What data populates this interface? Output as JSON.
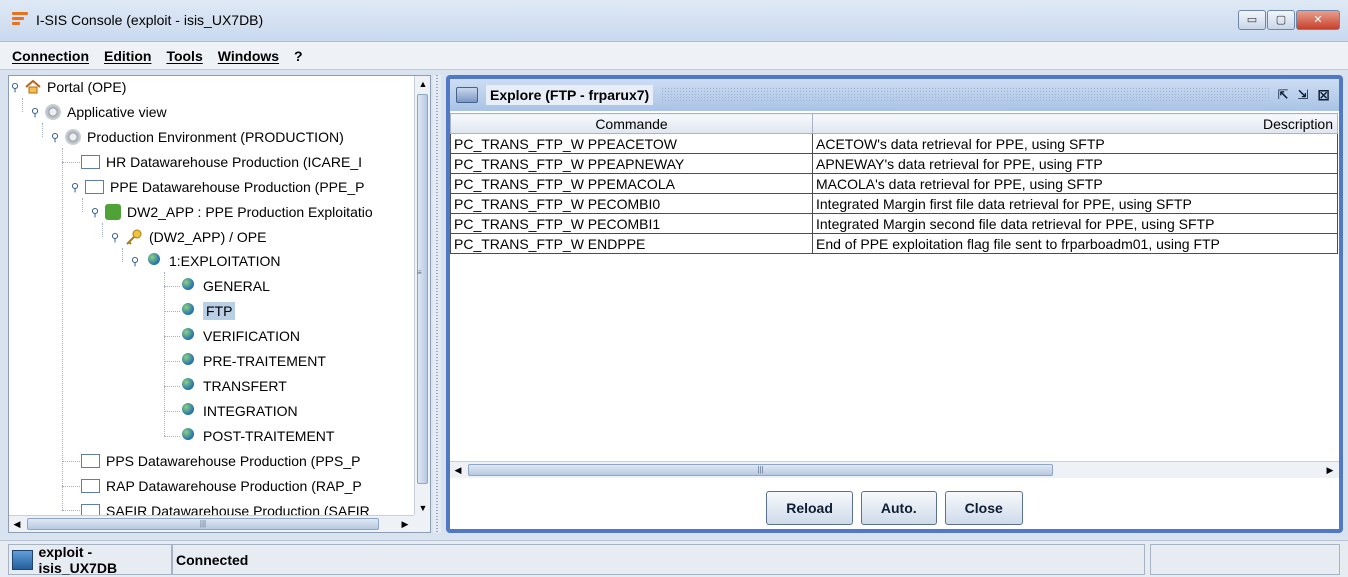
{
  "window": {
    "title": "I-SIS Console (exploit - isis_UX7DB)",
    "minimize_label": "▭",
    "maximize_label": "▢",
    "close_label": "✕"
  },
  "menu": [
    {
      "label": "Connection"
    },
    {
      "label": "Edition"
    },
    {
      "label": "Tools"
    },
    {
      "label": "Windows"
    },
    {
      "label": "?"
    }
  ],
  "tree": [
    {
      "label": "Portal (OPE)",
      "icon": "home-icon"
    },
    {
      "label": "Applicative view",
      "icon": "gear-icon"
    },
    {
      "label": "Production Environment (PRODUCTION)",
      "icon": "gear-icon"
    },
    {
      "label": "HR Datawarehouse Production (ICARE_I",
      "icon": "document-icon"
    },
    {
      "label": "PPE Datawarehouse Production (PPE_P",
      "icon": "document-icon"
    },
    {
      "label": "DW2_APP : PPE Production Exploitatio",
      "icon": "puzzle-icon"
    },
    {
      "label": "(DW2_APP) / OPE",
      "icon": "key-icon"
    },
    {
      "label": "1:EXPLOITATION",
      "icon": "globe-icon"
    },
    {
      "label": "GENERAL",
      "icon": "globe-icon"
    },
    {
      "label": "FTP",
      "icon": "globe-icon",
      "selected": true
    },
    {
      "label": "VERIFICATION",
      "icon": "globe-icon"
    },
    {
      "label": "PRE-TRAITEMENT",
      "icon": "globe-icon"
    },
    {
      "label": "TRANSFERT",
      "icon": "globe-icon"
    },
    {
      "label": "INTEGRATION",
      "icon": "globe-icon"
    },
    {
      "label": "POST-TRAITEMENT",
      "icon": "globe-icon"
    },
    {
      "label": "PPS Datawarehouse Production (PPS_P",
      "icon": "document-icon"
    },
    {
      "label": "RAP Datawarehouse Production (RAP_P",
      "icon": "document-icon"
    },
    {
      "label": "SAFIR Datawarehouse Production (SAFIR",
      "icon": "document-icon"
    }
  ],
  "explore": {
    "title": "Explore (FTP - frparux7)",
    "restore_label": "⇱",
    "maximize_label": "⇲",
    "close_label": "⊠",
    "columns": [
      "Commande",
      "Description"
    ],
    "rows": [
      [
        "PC_TRANS_FTP_W PPEACETOW",
        "ACETOW's data retrieval for PPE, using SFTP"
      ],
      [
        "PC_TRANS_FTP_W PPEAPNEWAY",
        "APNEWAY's data retrieval for PPE, using FTP"
      ],
      [
        "PC_TRANS_FTP_W PPEMACOLA",
        "MACOLA's data retrieval for PPE, using SFTP"
      ],
      [
        "PC_TRANS_FTP_W PECOMBI0",
        "Integrated Margin first file data retrieval for PPE, using SFTP"
      ],
      [
        "PC_TRANS_FTP_W PECOMBI1",
        "Integrated Margin second file data retrieval for PPE, using SFTP"
      ],
      [
        "PC_TRANS_FTP_W ENDPPE",
        "End of PPE exploitation flag file sent to frparboadm01, using FTP"
      ]
    ],
    "buttons": {
      "reload": "Reload",
      "auto": "Auto.",
      "close": "Close"
    }
  },
  "status": {
    "connection": "exploit - isis_UX7DB",
    "state": "Connected"
  }
}
